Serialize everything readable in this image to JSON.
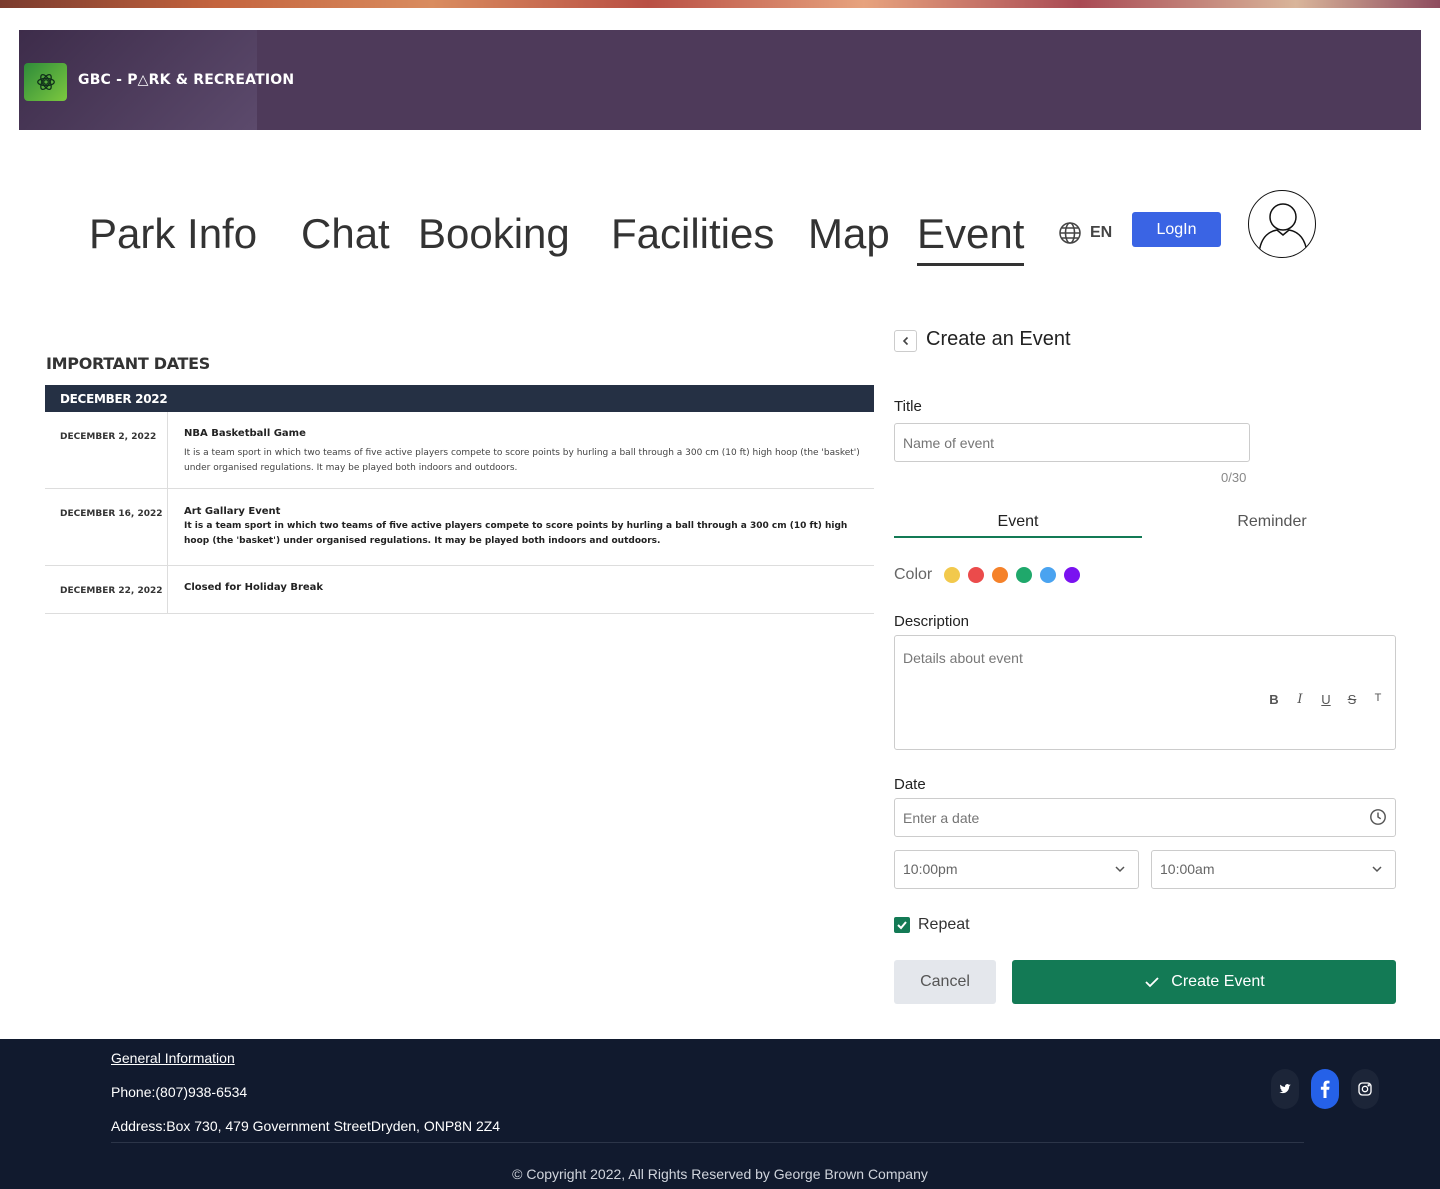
{
  "brand": {
    "name": "GBC - P△RK & RECREATION"
  },
  "nav": {
    "items": [
      "Park Info",
      "Chat",
      "Booking",
      "Facilities",
      "Map",
      "Event"
    ],
    "active": "Event",
    "language": "EN",
    "login_label": "LogIn"
  },
  "dates": {
    "heading": "IMPORTANT DATES",
    "month": "DECEMBER 2022",
    "rows": [
      {
        "date": "DECEMBER 2, 2022",
        "title": "NBA Basketball Game",
        "text": "It is a team sport in which two teams of five active players compete to score points by hurling a ball through a 300 cm (10 ft) high hoop (the 'basket') under organised regulations. It may be played both indoors and outdoors."
      },
      {
        "date": "DECEMBER 16, 2022",
        "title": "Art Gallary Event",
        "text": "It is a team sport in which two teams of five active players compete to score points by hurling a ball through a 300 cm (10 ft) high hoop (the 'basket') under organised regulations. It may be played both indoors and outdoors."
      },
      {
        "date": "DECEMBER 22, 2022",
        "title": "Closed for Holiday Break",
        "text": ""
      }
    ]
  },
  "form": {
    "title": "Create an Event",
    "title_label": "Title",
    "title_placeholder": "Name of event",
    "counter": "0/30",
    "tabs": [
      "Event",
      "Reminder"
    ],
    "active_tab": "Event",
    "color_label": "Color",
    "colors": [
      "#f2c94c",
      "#eb4b4b",
      "#f5822a",
      "#1fa86b",
      "#4aa3f0",
      "#7a12f0"
    ],
    "description_label": "Description",
    "description_placeholder": "Details about event",
    "toolbar": [
      "B",
      "I",
      "U",
      "S",
      "T"
    ],
    "date_label": "Date",
    "date_placeholder": "Enter a date",
    "start_time": "10:00pm",
    "end_time": "10:00am",
    "repeat_label": "Repeat",
    "repeat_checked": true,
    "cancel_label": "Cancel",
    "create_label": "Create Event"
  },
  "footer": {
    "general_info": "General Information",
    "phone": "Phone:(807)938-6534",
    "address": "Address:Box 730, 479 Government StreetDryden, ONP8N 2Z4",
    "copyright": "© Copyright 2022, All Rights Reserved by George Brown Company",
    "social": [
      "twitter-icon",
      "facebook-icon",
      "instagram-icon"
    ]
  }
}
